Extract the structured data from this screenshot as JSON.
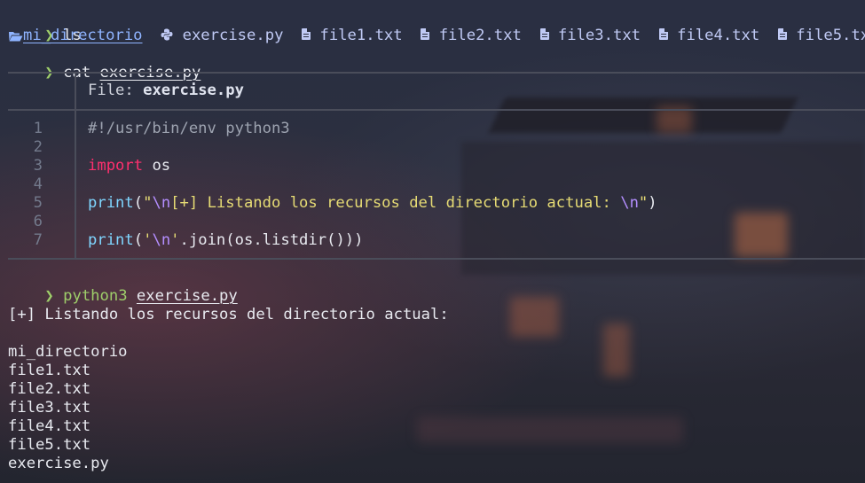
{
  "prompt_symbol": "❯",
  "commands": {
    "ls": "ls",
    "cat": "cat",
    "cat_arg": "exercise.py",
    "python": "python3",
    "python_arg": "exercise.py"
  },
  "ls_output": {
    "directory": "mi_directorio",
    "python_file": "exercise.py",
    "files": [
      "file1.txt",
      "file2.txt",
      "file3.txt",
      "file4.txt",
      "file5.txt"
    ]
  },
  "bat": {
    "header_label": "File:",
    "header_file": "exercise.py",
    "line_numbers": [
      "1",
      "2",
      "3",
      "4",
      "5",
      "6",
      "7"
    ],
    "code": {
      "shebang": "#!/usr/bin/env python3",
      "import_kw": "import",
      "import_mod": " os",
      "print1_fn": "print",
      "print1_open": "(",
      "print1_str_a": "\"",
      "print1_esc_a": "\\n",
      "print1_str_b": "[+] Listando los recursos del directorio actual: ",
      "print1_esc_b": "\\n",
      "print1_str_c": "\"",
      "print1_close": ")",
      "print2_fn": "print",
      "print2_open": "(",
      "print2_str_a": "'",
      "print2_esc": "\\n",
      "print2_str_b": "'",
      "print2_rest": ".join(os.listdir()))"
    }
  },
  "program_output": {
    "header": "[+] Listando los recursos del directorio actual:",
    "entries": [
      "mi_directorio",
      "file1.txt",
      "file2.txt",
      "file3.txt",
      "file4.txt",
      "file5.txt",
      "exercise.py"
    ]
  },
  "colors": {
    "prompt": "#9ece6a",
    "keyword": "#ff2f6e",
    "function": "#7fd6ff",
    "string": "#e6db74",
    "escape": "#b48eff",
    "directory": "#8fb4ff"
  }
}
